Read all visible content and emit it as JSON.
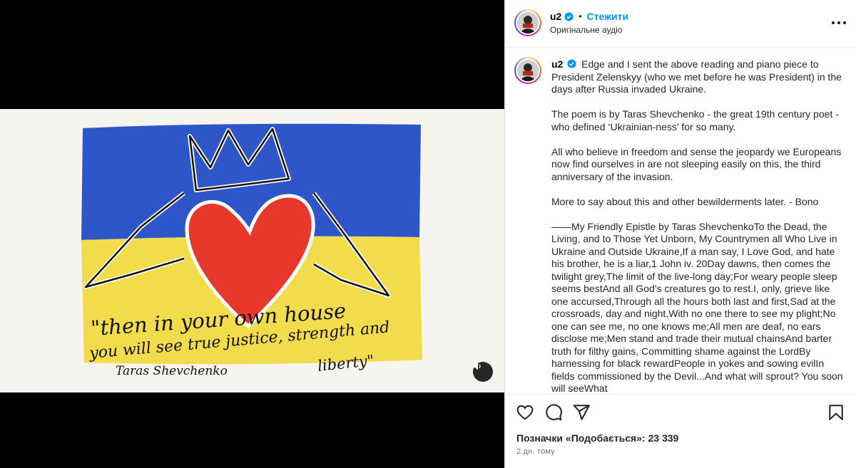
{
  "header": {
    "username": "u2",
    "separator": "•",
    "follow_label": "Стежити",
    "audio_label": "Оригінальне аудіо"
  },
  "icons": {
    "verified": "verified-badge-icon",
    "more": "more-options-icon",
    "mute": "speaker-icon",
    "like": "heart-icon",
    "comment": "comment-icon",
    "share": "paper-plane-icon",
    "save": "bookmark-icon"
  },
  "colors": {
    "follow": "#0095f6",
    "verified": "#0095f6",
    "flag_blue": "#2f56c8",
    "flag_yellow": "#f2dc4c",
    "heart": "#e8382c"
  },
  "artwork": {
    "quote_line1": "\"then in your own house",
    "quote_line2": "you will see true justice, strength and",
    "quote_line3": "liberty\"",
    "signature": "Taras Shevchenko"
  },
  "caption": {
    "username": "u2",
    "paragraphs": [
      "Edge and I sent the above reading and piano piece to President Zelenskyy (who we met before he was President) in the days after Russia invaded Ukraine.",
      "The poem is by Taras Shevchenko - the great 19th century poet - who defined ‘Ukrainian-ness’ for so many.",
      "All who believe in freedom and sense the jeopardy we Europeans now find ourselves in are not sleeping easily on this, the third anniversary of the invasion.",
      "More to say about this and other bewilderments later. - Bono",
      "——My Friendly Epistle by Taras ShevchenkoTo the Dead, the Living, and to Those Yet Unborn, My Countrymen all Who Live in Ukraine and Outside Ukraine,If a man say, I Love God, and hate his brother, he is a liar,1 John iv. 20Day dawns, then comes the twilight grey,The limit of the live-long day;For weary people sleep seems bestAnd all God’s creatures go to rest.I, only, grieve like one accursed,Through all the hours both last and first,Sad at the crossroads, day and night,With no one there to see my plight;No one can see me, no one knows me;All men are deaf, no ears disclose me;Men stand and trade their mutual chainsAnd barter truth for filthy gains, Committing shame against the LordBy harnessing for black rewardPeople in yokes and sowing evilIn fields commissioned by the Devil...And what will sprout? You soon will seeWhat"
    ]
  },
  "footer": {
    "likes_text": "Позначки «Подобається»: 23 339",
    "time_text": "2 дн. тому"
  }
}
